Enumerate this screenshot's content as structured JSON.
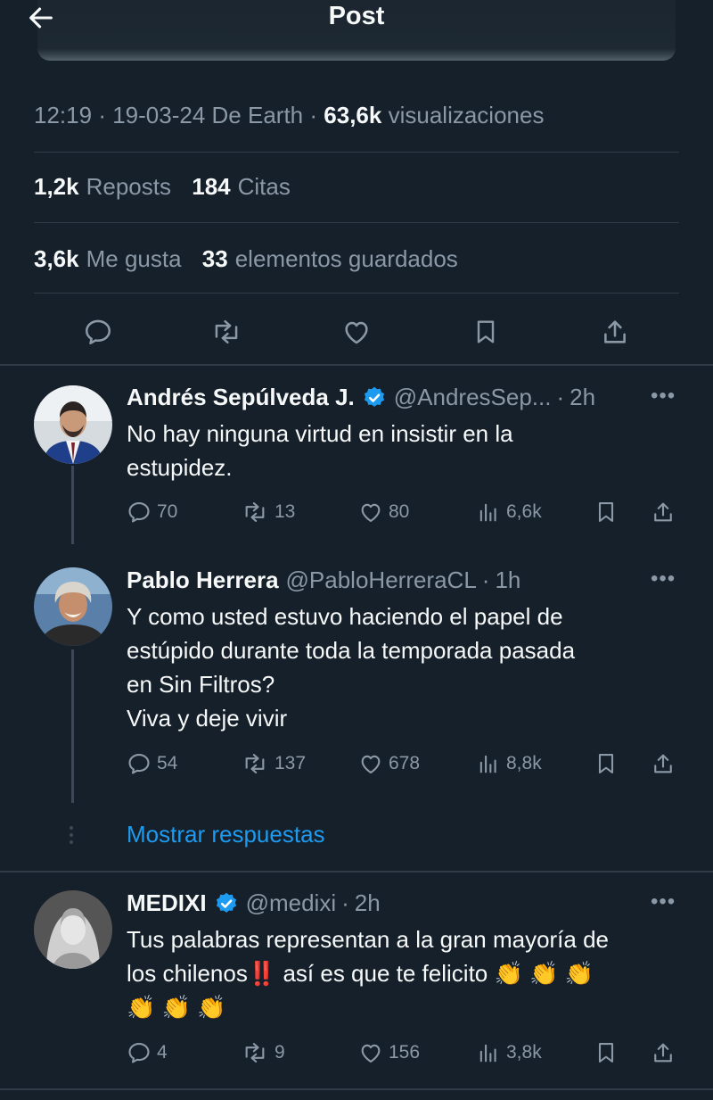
{
  "header": {
    "title": "Post"
  },
  "meta": {
    "time": "12:19",
    "date": "19-03-24",
    "source": "De Earth",
    "views_count": "63,6k",
    "views_label": "visualizaciones"
  },
  "stats": {
    "reposts_count": "1,2k",
    "reposts_label": "Reposts",
    "quotes_count": "184",
    "quotes_label": "Citas",
    "likes_count": "3,6k",
    "likes_label": "Me gusta",
    "saved_count": "33",
    "saved_label": "elementos guardados"
  },
  "actions": [
    "reply-icon",
    "repost-icon",
    "like-icon",
    "bookmark-icon",
    "share-icon"
  ],
  "replies": [
    {
      "name": "Andrés Sepúlveda J.",
      "verified": true,
      "handle": "@AndresSep...",
      "time": "2h",
      "lines": [
        "No hay ninguna virtud en insistir en la",
        "estupidez."
      ],
      "replies": "70",
      "reposts": "13",
      "likes": "80",
      "views": "6,6k"
    },
    {
      "name": "Pablo Herrera",
      "verified": false,
      "handle": "@PabloHerreraCL",
      "time": "1h",
      "lines": [
        "Y como usted estuvo haciendo el papel de",
        "estúpido durante toda la temporada pasada",
        "en Sin Filtros?",
        "Viva y deje vivir"
      ],
      "replies": "54",
      "reposts": "137",
      "likes": "678",
      "views": "8,8k"
    },
    {
      "name": "MEDIXI",
      "verified": true,
      "handle": "@medixi",
      "time": "2h",
      "line1": "Tus palabras representan a la gran mayoría de",
      "line2_text": "los chilenos",
      "line2_mark": "‼️",
      "line2_rest": " así es que te felicito ",
      "clap_row_1": "👏 👏 👏",
      "clap_row_2": "👏 👏 👏",
      "replies": "4",
      "reposts": "9",
      "likes": "156",
      "views": "3,8k"
    }
  ],
  "show_replies": "Mostrar respuestas",
  "separators": {
    "dot": "·"
  },
  "colors": {
    "background": "#15202b",
    "accent": "#1d9bf0",
    "muted": "#8b98a5",
    "verified": "#1d9bf0"
  }
}
